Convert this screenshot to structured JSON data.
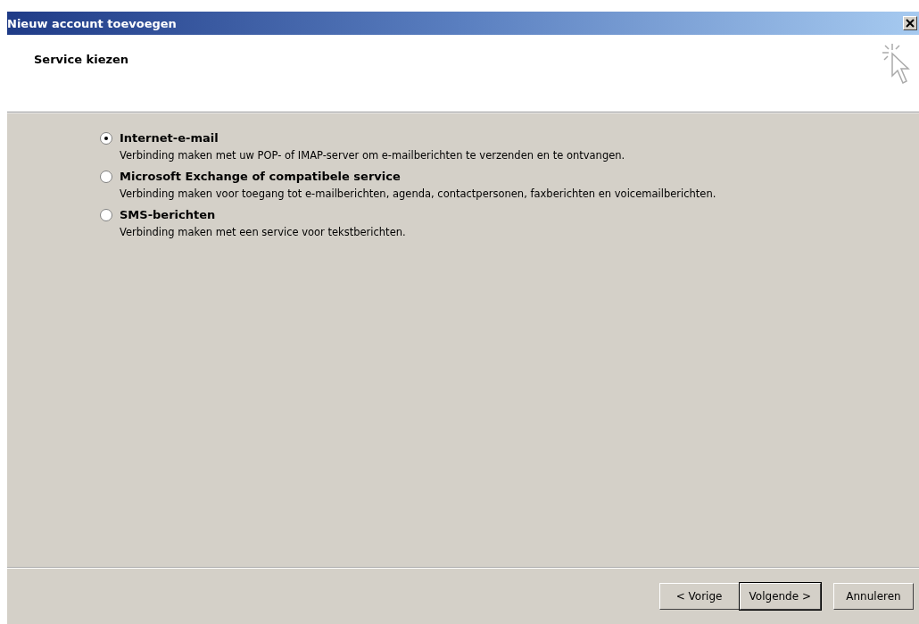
{
  "window": {
    "title": "Nieuw account toevoegen"
  },
  "header": {
    "title": "Service kiezen"
  },
  "options": [
    {
      "label": "Internet-e-mail",
      "description": "Verbinding maken met uw POP- of IMAP-server om e-mailberichten te verzenden en te ontvangen.",
      "selected": true
    },
    {
      "label": "Microsoft Exchange of compatibele service",
      "description": "Verbinding maken voor toegang tot e-mailberichten, agenda, contactpersonen, faxberichten en voicemailberichten.",
      "selected": false
    },
    {
      "label": "SMS-berichten",
      "description": "Verbinding maken met een service voor tekstberichten.",
      "selected": false
    }
  ],
  "buttons": [
    {
      "label": "< Vorige",
      "default": false
    },
    {
      "label": "Volgende >",
      "default": true
    },
    {
      "label": "Annuleren",
      "default": false
    }
  ]
}
